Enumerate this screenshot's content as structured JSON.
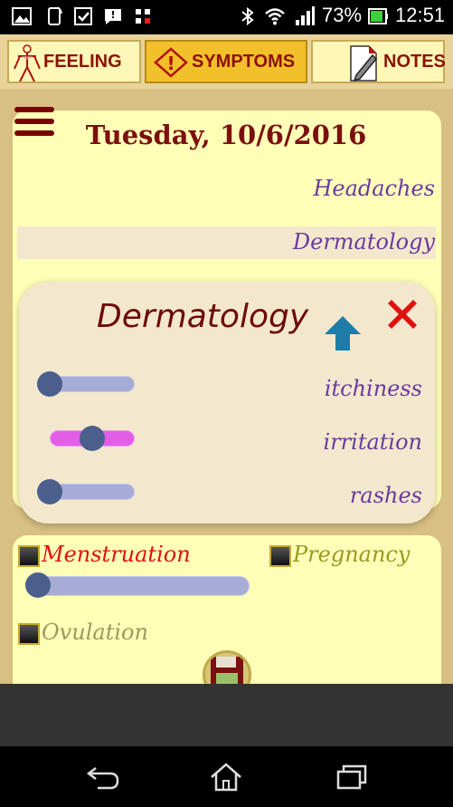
{
  "status_bar": {
    "battery_percent": "73%",
    "time": "12:51",
    "icons": [
      "gallery-icon",
      "phone-screen-icon",
      "checkbox-icon",
      "message-icon",
      "network-crossed-icon",
      "bluetooth-icon",
      "wifi-icon",
      "signal-icon",
      "battery-icon"
    ]
  },
  "tabs": [
    {
      "label": "FEELING",
      "icon": "body-figure-icon",
      "active": false
    },
    {
      "label": "SYMPTOMS",
      "icon": "warning-icon",
      "active": true
    },
    {
      "label": "NOTES",
      "icon": "pencil-note-icon",
      "active": false
    }
  ],
  "header": {
    "date": "Tuesday, 10/6/2016"
  },
  "categories": [
    {
      "label": "Headaches"
    },
    {
      "label": "Dermatology"
    }
  ],
  "dialog": {
    "title": "Dermatology",
    "symptoms": [
      {
        "label": "itchiness",
        "level": 0.0,
        "active": false
      },
      {
        "label": "irritation",
        "level": 0.5,
        "active": true
      },
      {
        "label": "rashes",
        "level": 0.0,
        "active": false
      }
    ]
  },
  "cycle": {
    "menstruation": {
      "label": "Menstruation",
      "checked": false,
      "level": 0.0
    },
    "pregnancy": {
      "label": "Pregnancy",
      "checked": false
    },
    "ovulation": {
      "label": "Ovulation",
      "checked": false
    }
  },
  "colors": {
    "accent_dark_red": "#7a1010",
    "category_purple": "#6a3aa0",
    "menstruation_red": "#e01010",
    "pregnancy_olive": "#9a9a20",
    "ovulation_olive": "#9a9a60",
    "active_tab": "#f2c02a"
  },
  "navigation": [
    "back-icon",
    "home-icon",
    "recent-apps-icon"
  ]
}
